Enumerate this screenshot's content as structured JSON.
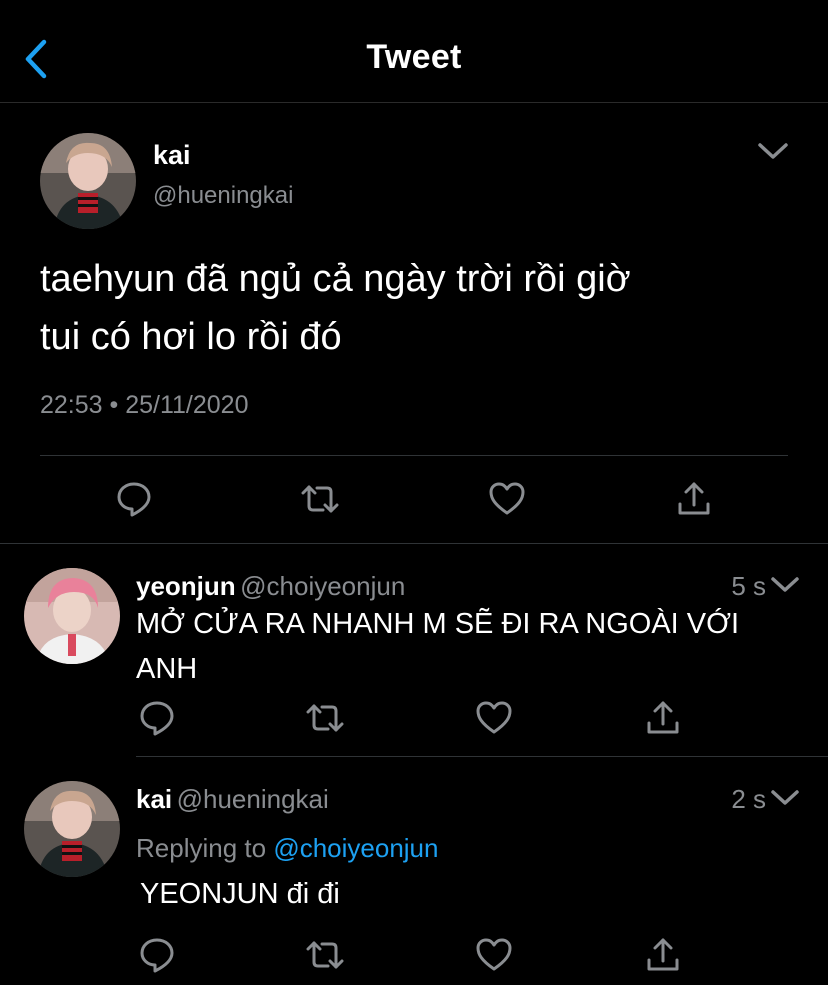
{
  "header": {
    "title": "Tweet"
  },
  "main_tweet": {
    "name": "kai",
    "handle": "@hueningkai",
    "text_line1": "taehyun đã ngủ cả ngày trời rồi giờ",
    "text_line2": "tui có hơi lo rồi đó",
    "timestamp": "22:53 • 25/11/2020"
  },
  "replies": [
    {
      "name": "yeonjun",
      "handle": "@choiyeonjun",
      "time": "5 s",
      "text_line1": "MỞ CỬA RA NHANH M SẼ ĐI RA NGOÀI VỚI",
      "text_line2": "ANH"
    },
    {
      "name": "kai",
      "handle": "@hueningkai",
      "time": "2 s",
      "replying_label": "Replying to",
      "replying_mention": "@choiyeonjun",
      "text": "YEONJUN đi đi"
    }
  ],
  "icons": [
    "back-icon",
    "chevron-down-icon",
    "reply-icon",
    "retweet-icon",
    "like-icon",
    "share-icon"
  ],
  "colors": {
    "background": "#000000",
    "accent": "#1da1f2",
    "secondary_text": "#8a8d91",
    "divider": "#2f3336"
  }
}
